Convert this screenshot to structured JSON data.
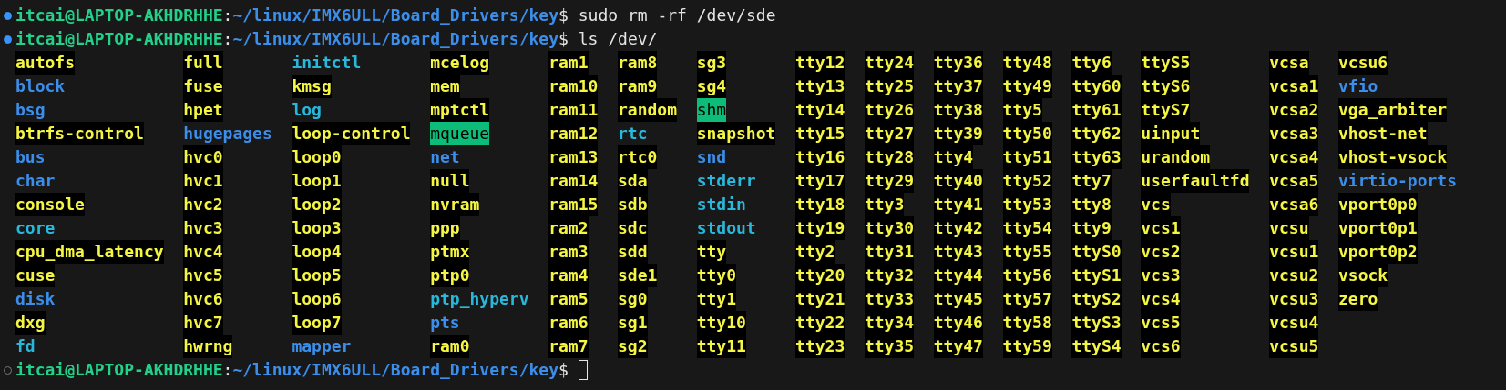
{
  "terminal": {
    "lines": [
      {
        "done": true,
        "user": "itcai@LAPTOP-AKHDRHHE",
        "sep": ":",
        "path": "~/linux/IMX6ULL/Board_Drivers/key",
        "symbol": "$",
        "command": "sudo rm -rf /dev/sde"
      },
      {
        "done": true,
        "user": "itcai@LAPTOP-AKHDRHHE",
        "sep": ":",
        "path": "~/linux/IMX6ULL/Board_Drivers/key",
        "symbol": "$",
        "command": "ls /dev/"
      }
    ],
    "listing": {
      "columns": [
        [
          {
            "name": "autofs",
            "kind": "device"
          },
          {
            "name": "block",
            "kind": "dir"
          },
          {
            "name": "bsg",
            "kind": "dir"
          },
          {
            "name": "btrfs-control",
            "kind": "device"
          },
          {
            "name": "bus",
            "kind": "dir"
          },
          {
            "name": "char",
            "kind": "dir"
          },
          {
            "name": "console",
            "kind": "device"
          },
          {
            "name": "core",
            "kind": "link"
          },
          {
            "name": "cpu_dma_latency",
            "kind": "device"
          },
          {
            "name": "cuse",
            "kind": "device"
          },
          {
            "name": "disk",
            "kind": "dir"
          },
          {
            "name": "dxg",
            "kind": "device"
          },
          {
            "name": "fd",
            "kind": "link"
          }
        ],
        [
          {
            "name": "full",
            "kind": "device"
          },
          {
            "name": "fuse",
            "kind": "device"
          },
          {
            "name": "hpet",
            "kind": "device"
          },
          {
            "name": "hugepages",
            "kind": "dir"
          },
          {
            "name": "hvc0",
            "kind": "device"
          },
          {
            "name": "hvc1",
            "kind": "device"
          },
          {
            "name": "hvc2",
            "kind": "device"
          },
          {
            "name": "hvc3",
            "kind": "device"
          },
          {
            "name": "hvc4",
            "kind": "device"
          },
          {
            "name": "hvc5",
            "kind": "device"
          },
          {
            "name": "hvc6",
            "kind": "device"
          },
          {
            "name": "hvc7",
            "kind": "device"
          },
          {
            "name": "hwrng",
            "kind": "device"
          }
        ],
        [
          {
            "name": "initctl",
            "kind": "link"
          },
          {
            "name": "kmsg",
            "kind": "device"
          },
          {
            "name": "log",
            "kind": "link"
          },
          {
            "name": "loop-control",
            "kind": "device"
          },
          {
            "name": "loop0",
            "kind": "device"
          },
          {
            "name": "loop1",
            "kind": "device"
          },
          {
            "name": "loop2",
            "kind": "device"
          },
          {
            "name": "loop3",
            "kind": "device"
          },
          {
            "name": "loop4",
            "kind": "device"
          },
          {
            "name": "loop5",
            "kind": "device"
          },
          {
            "name": "loop6",
            "kind": "device"
          },
          {
            "name": "loop7",
            "kind": "device"
          },
          {
            "name": "mapper",
            "kind": "dir"
          }
        ],
        [
          {
            "name": "mcelog",
            "kind": "device"
          },
          {
            "name": "mem",
            "kind": "device"
          },
          {
            "name": "mptctl",
            "kind": "device"
          },
          {
            "name": "mqueue",
            "kind": "sticky"
          },
          {
            "name": "net",
            "kind": "dir"
          },
          {
            "name": "null",
            "kind": "device"
          },
          {
            "name": "nvram",
            "kind": "device"
          },
          {
            "name": "ppp",
            "kind": "device"
          },
          {
            "name": "ptmx",
            "kind": "device"
          },
          {
            "name": "ptp0",
            "kind": "device"
          },
          {
            "name": "ptp_hyperv",
            "kind": "link"
          },
          {
            "name": "pts",
            "kind": "dir"
          },
          {
            "name": "ram0",
            "kind": "device"
          }
        ],
        [
          {
            "name": "ram1",
            "kind": "device"
          },
          {
            "name": "ram10",
            "kind": "device"
          },
          {
            "name": "ram11",
            "kind": "device"
          },
          {
            "name": "ram12",
            "kind": "device"
          },
          {
            "name": "ram13",
            "kind": "device"
          },
          {
            "name": "ram14",
            "kind": "device"
          },
          {
            "name": "ram15",
            "kind": "device"
          },
          {
            "name": "ram2",
            "kind": "device"
          },
          {
            "name": "ram3",
            "kind": "device"
          },
          {
            "name": "ram4",
            "kind": "device"
          },
          {
            "name": "ram5",
            "kind": "device"
          },
          {
            "name": "ram6",
            "kind": "device"
          },
          {
            "name": "ram7",
            "kind": "device"
          }
        ],
        [
          {
            "name": "ram8",
            "kind": "device"
          },
          {
            "name": "ram9",
            "kind": "device"
          },
          {
            "name": "random",
            "kind": "device"
          },
          {
            "name": "rtc",
            "kind": "link"
          },
          {
            "name": "rtc0",
            "kind": "device"
          },
          {
            "name": "sda",
            "kind": "device"
          },
          {
            "name": "sdb",
            "kind": "device"
          },
          {
            "name": "sdc",
            "kind": "device"
          },
          {
            "name": "sdd",
            "kind": "device"
          },
          {
            "name": "sde1",
            "kind": "device"
          },
          {
            "name": "sg0",
            "kind": "device"
          },
          {
            "name": "sg1",
            "kind": "device"
          },
          {
            "name": "sg2",
            "kind": "device"
          }
        ],
        [
          {
            "name": "sg3",
            "kind": "device"
          },
          {
            "name": "sg4",
            "kind": "device"
          },
          {
            "name": "shm",
            "kind": "sticky"
          },
          {
            "name": "snapshot",
            "kind": "device"
          },
          {
            "name": "snd",
            "kind": "dir"
          },
          {
            "name": "stderr",
            "kind": "link"
          },
          {
            "name": "stdin",
            "kind": "link"
          },
          {
            "name": "stdout",
            "kind": "link"
          },
          {
            "name": "tty",
            "kind": "device"
          },
          {
            "name": "tty0",
            "kind": "device"
          },
          {
            "name": "tty1",
            "kind": "device"
          },
          {
            "name": "tty10",
            "kind": "device"
          },
          {
            "name": "tty11",
            "kind": "device"
          }
        ],
        [
          {
            "name": "tty12",
            "kind": "device"
          },
          {
            "name": "tty13",
            "kind": "device"
          },
          {
            "name": "tty14",
            "kind": "device"
          },
          {
            "name": "tty15",
            "kind": "device"
          },
          {
            "name": "tty16",
            "kind": "device"
          },
          {
            "name": "tty17",
            "kind": "device"
          },
          {
            "name": "tty18",
            "kind": "device"
          },
          {
            "name": "tty19",
            "kind": "device"
          },
          {
            "name": "tty2",
            "kind": "device"
          },
          {
            "name": "tty20",
            "kind": "device"
          },
          {
            "name": "tty21",
            "kind": "device"
          },
          {
            "name": "tty22",
            "kind": "device"
          },
          {
            "name": "tty23",
            "kind": "device"
          }
        ],
        [
          {
            "name": "tty24",
            "kind": "device"
          },
          {
            "name": "tty25",
            "kind": "device"
          },
          {
            "name": "tty26",
            "kind": "device"
          },
          {
            "name": "tty27",
            "kind": "device"
          },
          {
            "name": "tty28",
            "kind": "device"
          },
          {
            "name": "tty29",
            "kind": "device"
          },
          {
            "name": "tty3",
            "kind": "device"
          },
          {
            "name": "tty30",
            "kind": "device"
          },
          {
            "name": "tty31",
            "kind": "device"
          },
          {
            "name": "tty32",
            "kind": "device"
          },
          {
            "name": "tty33",
            "kind": "device"
          },
          {
            "name": "tty34",
            "kind": "device"
          },
          {
            "name": "tty35",
            "kind": "device"
          }
        ],
        [
          {
            "name": "tty36",
            "kind": "device"
          },
          {
            "name": "tty37",
            "kind": "device"
          },
          {
            "name": "tty38",
            "kind": "device"
          },
          {
            "name": "tty39",
            "kind": "device"
          },
          {
            "name": "tty4",
            "kind": "device"
          },
          {
            "name": "tty40",
            "kind": "device"
          },
          {
            "name": "tty41",
            "kind": "device"
          },
          {
            "name": "tty42",
            "kind": "device"
          },
          {
            "name": "tty43",
            "kind": "device"
          },
          {
            "name": "tty44",
            "kind": "device"
          },
          {
            "name": "tty45",
            "kind": "device"
          },
          {
            "name": "tty46",
            "kind": "device"
          },
          {
            "name": "tty47",
            "kind": "device"
          }
        ],
        [
          {
            "name": "tty48",
            "kind": "device"
          },
          {
            "name": "tty49",
            "kind": "device"
          },
          {
            "name": "tty5",
            "kind": "device"
          },
          {
            "name": "tty50",
            "kind": "device"
          },
          {
            "name": "tty51",
            "kind": "device"
          },
          {
            "name": "tty52",
            "kind": "device"
          },
          {
            "name": "tty53",
            "kind": "device"
          },
          {
            "name": "tty54",
            "kind": "device"
          },
          {
            "name": "tty55",
            "kind": "device"
          },
          {
            "name": "tty56",
            "kind": "device"
          },
          {
            "name": "tty57",
            "kind": "device"
          },
          {
            "name": "tty58",
            "kind": "device"
          },
          {
            "name": "tty59",
            "kind": "device"
          }
        ],
        [
          {
            "name": "tty6",
            "kind": "device"
          },
          {
            "name": "tty60",
            "kind": "device"
          },
          {
            "name": "tty61",
            "kind": "device"
          },
          {
            "name": "tty62",
            "kind": "device"
          },
          {
            "name": "tty63",
            "kind": "device"
          },
          {
            "name": "tty7",
            "kind": "device"
          },
          {
            "name": "tty8",
            "kind": "device"
          },
          {
            "name": "tty9",
            "kind": "device"
          },
          {
            "name": "ttyS0",
            "kind": "device"
          },
          {
            "name": "ttyS1",
            "kind": "device"
          },
          {
            "name": "ttyS2",
            "kind": "device"
          },
          {
            "name": "ttyS3",
            "kind": "device"
          },
          {
            "name": "ttyS4",
            "kind": "device"
          }
        ],
        [
          {
            "name": "ttyS5",
            "kind": "device"
          },
          {
            "name": "ttyS6",
            "kind": "device"
          },
          {
            "name": "ttyS7",
            "kind": "device"
          },
          {
            "name": "uinput",
            "kind": "device"
          },
          {
            "name": "urandom",
            "kind": "device"
          },
          {
            "name": "userfaultfd",
            "kind": "device"
          },
          {
            "name": "vcs",
            "kind": "device"
          },
          {
            "name": "vcs1",
            "kind": "device"
          },
          {
            "name": "vcs2",
            "kind": "device"
          },
          {
            "name": "vcs3",
            "kind": "device"
          },
          {
            "name": "vcs4",
            "kind": "device"
          },
          {
            "name": "vcs5",
            "kind": "device"
          },
          {
            "name": "vcs6",
            "kind": "device"
          }
        ],
        [
          {
            "name": "vcsa",
            "kind": "device"
          },
          {
            "name": "vcsa1",
            "kind": "device"
          },
          {
            "name": "vcsa2",
            "kind": "device"
          },
          {
            "name": "vcsa3",
            "kind": "device"
          },
          {
            "name": "vcsa4",
            "kind": "device"
          },
          {
            "name": "vcsa5",
            "kind": "device"
          },
          {
            "name": "vcsa6",
            "kind": "device"
          },
          {
            "name": "vcsu",
            "kind": "device"
          },
          {
            "name": "vcsu1",
            "kind": "device"
          },
          {
            "name": "vcsu2",
            "kind": "device"
          },
          {
            "name": "vcsu3",
            "kind": "device"
          },
          {
            "name": "vcsu4",
            "kind": "device"
          },
          {
            "name": "vcsu5",
            "kind": "device"
          }
        ],
        [
          {
            "name": "vcsu6",
            "kind": "device"
          },
          {
            "name": "vfio",
            "kind": "dir"
          },
          {
            "name": "vga_arbiter",
            "kind": "device"
          },
          {
            "name": "vhost-net",
            "kind": "device"
          },
          {
            "name": "vhost-vsock",
            "kind": "device"
          },
          {
            "name": "virtio-ports",
            "kind": "dir"
          },
          {
            "name": "vport0p0",
            "kind": "device"
          },
          {
            "name": "vport0p1",
            "kind": "device"
          },
          {
            "name": "vport0p2",
            "kind": "device"
          },
          {
            "name": "vsock",
            "kind": "device"
          },
          {
            "name": "zero",
            "kind": "device"
          }
        ]
      ]
    },
    "prompt": {
      "done": false,
      "user": "itcai@LAPTOP-AKHDRHHE",
      "sep": ":",
      "path": "~/linux/IMX6ULL/Board_Drivers/key",
      "symbol": "$",
      "cursor": true
    }
  }
}
